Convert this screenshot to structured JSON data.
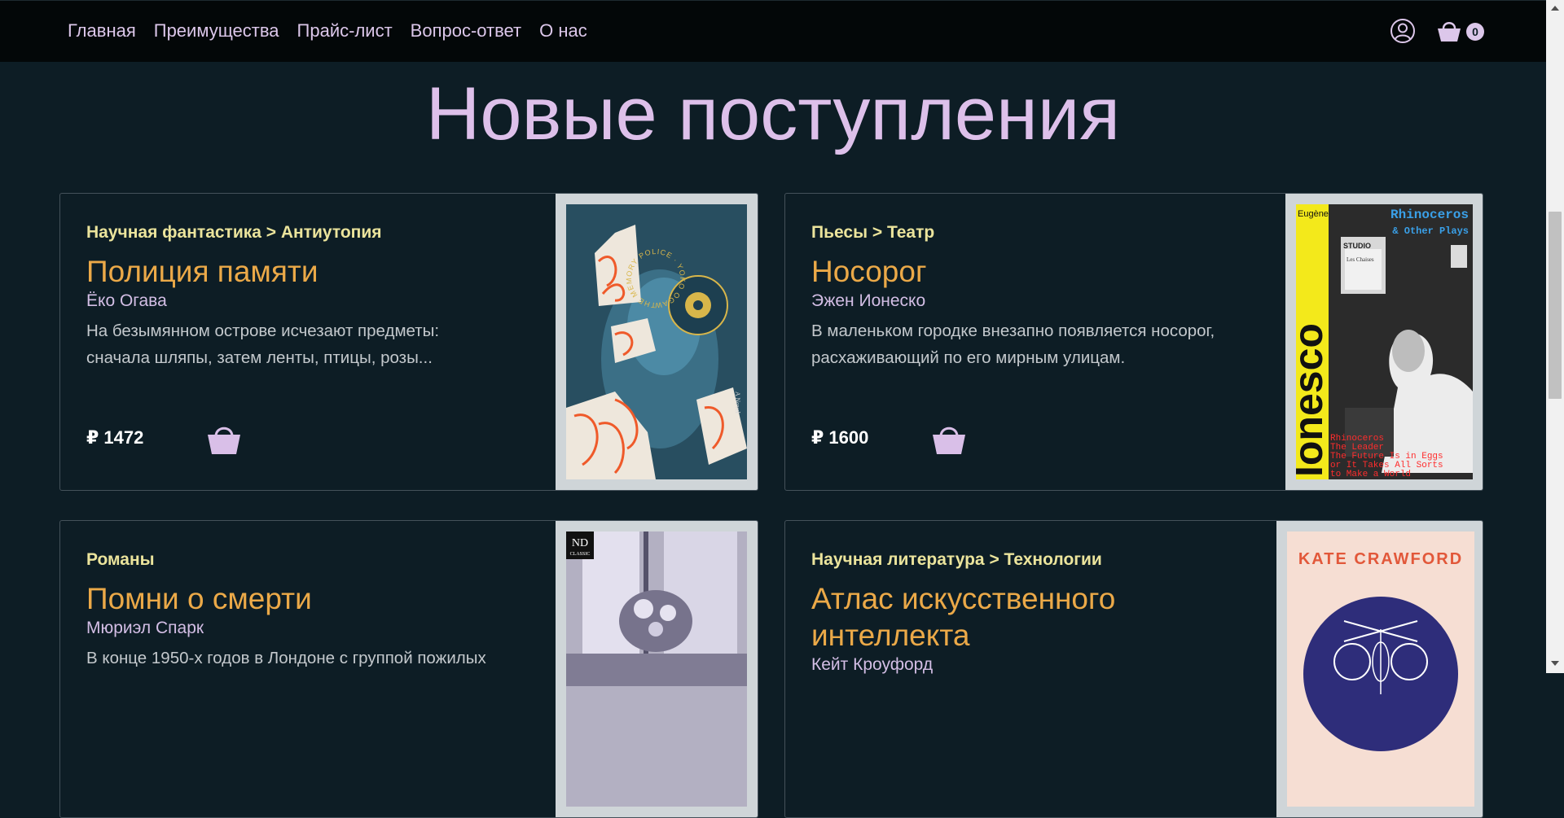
{
  "nav": {
    "links": [
      "Главная",
      "Преимущества",
      "Прайс-лист",
      "Вопрос-ответ",
      "О нас"
    ],
    "cart_count": "0"
  },
  "heading": "Новые поступления",
  "books": [
    {
      "category": "Научная фантастика > Антиутопия",
      "title": "Полиция памяти",
      "author": "Ёко Огава",
      "description": "На безымянном острове исчезают предметы: сначала шляпы, затем ленты, птицы, розы...",
      "price": "₽ 1472",
      "cover": {
        "badge_text": "THE MEMORY POLICE · YOKO OGAWA ·",
        "side_text": "A Novel"
      }
    },
    {
      "category": "Пьесы > Театр",
      "title": "Носорог",
      "author": "Эжен Ионеско",
      "description": "В маленьком городке внезапно появляется носорог, расхаживающий по его мирным улицам.",
      "price": "₽ 1600",
      "cover": {
        "author_first": "Eugène",
        "author_last": "Ionesco",
        "title": "Rhinoceros",
        "subtitle": "& Other Plays",
        "sign_1": "STUDIO",
        "sign_2": "Les Chaises",
        "contents": [
          "Rhinoceros",
          "The Leader",
          "The Future Is in Eggs",
          "or It Takes All Sorts",
          "to Make a World"
        ]
      }
    },
    {
      "category": "Романы",
      "title": "Помни о смерти",
      "author": "Мюриэл Спарк",
      "description": "В конце 1950-х годов в Лондоне с группой пожилых",
      "price": "",
      "cover": {
        "badge": "ND",
        "badge_sub": "CLASSIC"
      }
    },
    {
      "category": "Научная литература > Технологии",
      "title": "Атлас искусственного интеллекта",
      "author": "Кейт Кроуфорд",
      "description": "",
      "price": "",
      "cover": {
        "author": "KATE CRAWFORD"
      }
    }
  ],
  "colors": {
    "background": "#0d1d25",
    "nav_background": "#030708",
    "accent_lilac": "#ddc0ea",
    "category_yellow": "#ebe49c",
    "title_orange": "#eba948"
  },
  "icons": [
    "user-icon",
    "cart-icon",
    "basket-icon"
  ]
}
